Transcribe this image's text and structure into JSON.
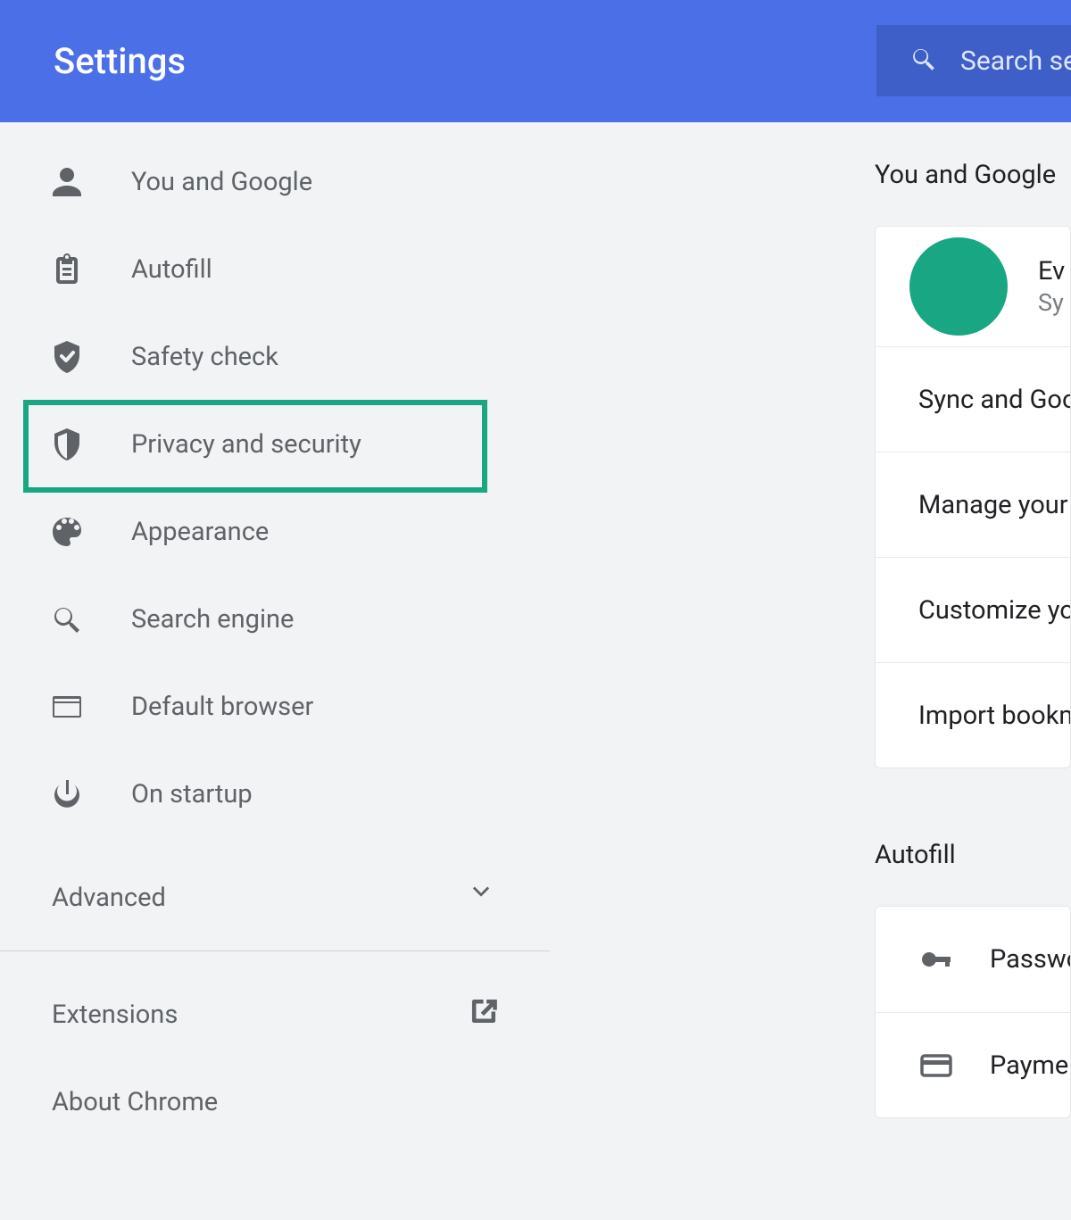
{
  "header": {
    "title": "Settings",
    "search_placeholder": "Search settings"
  },
  "sidebar": {
    "items": [
      {
        "icon": "person",
        "label": "You and Google"
      },
      {
        "icon": "clipboard",
        "label": "Autofill"
      },
      {
        "icon": "shieldck",
        "label": "Safety check"
      },
      {
        "icon": "shield",
        "label": "Privacy and security"
      },
      {
        "icon": "palette",
        "label": "Appearance"
      },
      {
        "icon": "search",
        "label": "Search engine"
      },
      {
        "icon": "browser",
        "label": "Default browser"
      },
      {
        "icon": "power",
        "label": "On startup"
      }
    ],
    "advanced_label": "Advanced",
    "extensions_label": "Extensions",
    "about_label": "About Chrome"
  },
  "main": {
    "section1_title": "You and Google",
    "profile": {
      "name": "Ev",
      "sub": "Sy"
    },
    "section1_rows": [
      "Sync and Google services",
      "Manage your Google Account",
      "Customize your Chrome profile",
      "Import bookmarks and settings"
    ],
    "section2_title": "Autofill",
    "section2_rows": [
      {
        "icon": "key",
        "label": "Passwords"
      },
      {
        "icon": "card",
        "label": "Payment methods"
      }
    ]
  },
  "colors": {
    "accent": "#4a6fe7",
    "avatar": "#18a683",
    "highlight": "#19a783"
  }
}
